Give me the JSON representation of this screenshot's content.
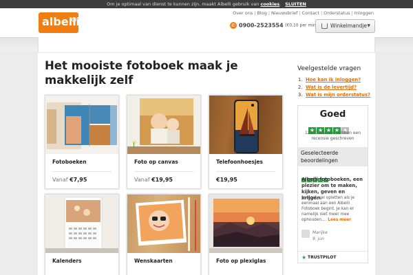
{
  "cookie_bar": {
    "text": "Om je optimaal van dienst te kunnen zijn, maakt Albelli gebruik van",
    "link": "cookies",
    "dot": ".",
    "close": "SLUITEN"
  },
  "header": {
    "logo": "albelli",
    "links": [
      "Over ons",
      "Blog",
      "Nieuwsbrief",
      "Contact",
      "Orderstatus",
      "Inloggen"
    ],
    "phone": "0900-2523554",
    "phone_rate": "(€0,10 per min)",
    "cart_label": "Winkelmandje"
  },
  "main": {
    "title": "Het mooiste fotoboek maak je makkelijk zelf",
    "products": [
      {
        "name": "Fotoboeken",
        "from": "Vanaf",
        "price": "€7,95"
      },
      {
        "name": "Foto op canvas",
        "from": "Vanaf",
        "price": "€19,95"
      },
      {
        "name": "Telefoonhoesjes",
        "from": "",
        "price": "€19,95"
      },
      {
        "name": "Kalenders",
        "from": "",
        "price": ""
      },
      {
        "name": "Wenskaarten",
        "from": "",
        "price": ""
      },
      {
        "name": "Foto op plexiglas",
        "from": "",
        "price": ""
      }
    ]
  },
  "sidebar": {
    "faq_title": "Veelgestelde vragen",
    "faq": [
      {
        "num": "1.",
        "label": "Hoe kan ik inloggen?"
      },
      {
        "num": "2.",
        "label": "Wat is de levertijd?"
      },
      {
        "num": "3.",
        "label": "Wat is mijn orderstatus?"
      }
    ],
    "trustpilot": {
      "rating_word": "Goed",
      "stars_on": 4,
      "count_text": "12107 klanten hebben een recensie geschreven",
      "selected_label": "Geselecteerde beoordelingen",
      "review_title": "Albelli fotoboeken, een plezier om te maken, kijken, geven en krijgen.",
      "review_body": "Je moet wel opletten als je eenmaal aan een Albelli Fotoboek begint. Je kan er namelijk niet meer mee ophouden....",
      "read_more": "Lees meer",
      "author": "Marijke",
      "date": "9. jun",
      "footer": "TRUSTPILOT"
    }
  },
  "colors": {
    "brand_orange": "#f07d12",
    "link_orange": "#e46f0a",
    "trust_green": "#2ea043",
    "cookie_bg": "#3c3c3c"
  }
}
